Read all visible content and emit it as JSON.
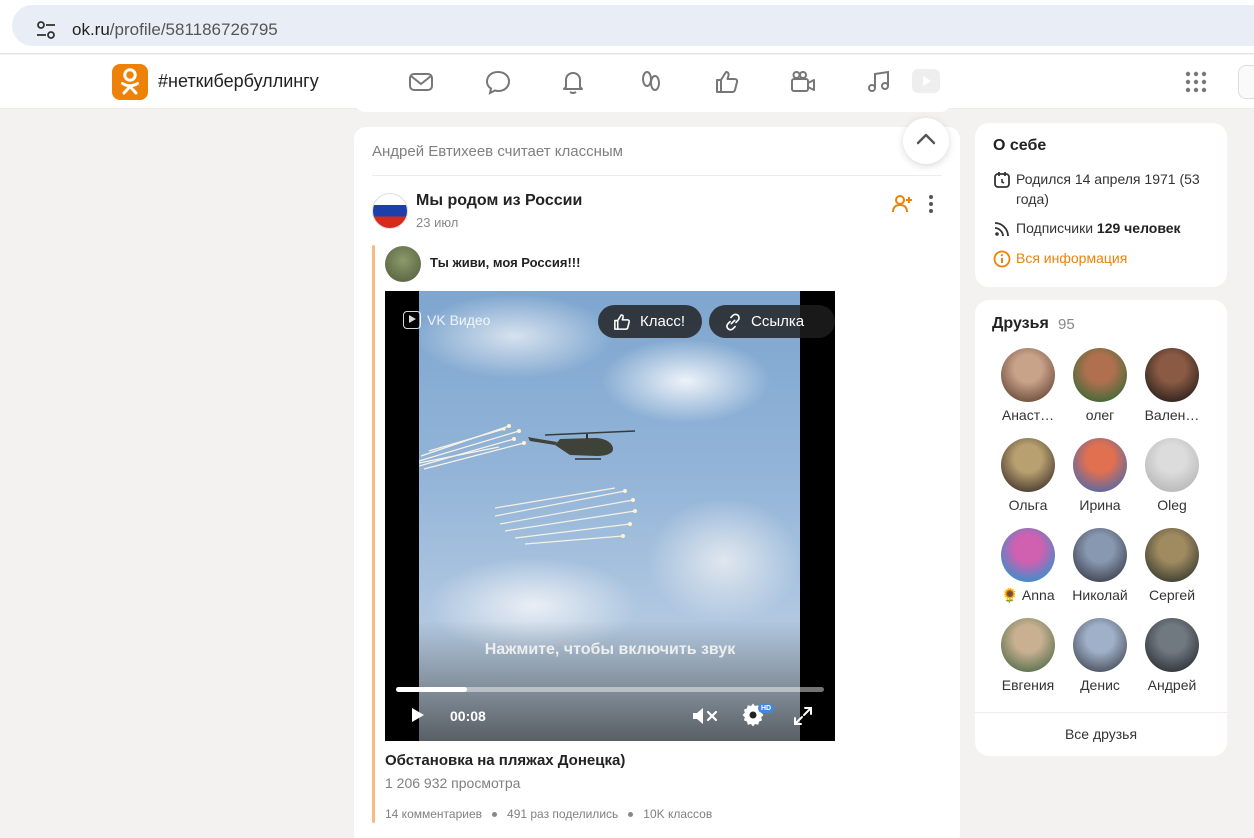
{
  "browser": {
    "url_domain": "ok.ru",
    "url_path": "/profile/581186726795"
  },
  "nav": {
    "brand": "#неткибербуллингу",
    "icons": [
      "mail-icon",
      "chat-icon",
      "bell-icon",
      "guests-icon",
      "like-icon",
      "camera-icon",
      "music-icon",
      "video-icon",
      "apps-icon"
    ]
  },
  "feed": {
    "header": "Андрей Евтихеев считает классным",
    "post": {
      "group_name": "Мы родом из России",
      "date": "23 июл",
      "repost_text": "Ты живи, моя Россия!!!",
      "video": {
        "brand": "VK Видео",
        "like_label": "Класс!",
        "link_label": "Ссылка",
        "sound_hint": "Нажмите, чтобы включить звук",
        "time": "00:08",
        "progress": 0.165,
        "hd_badge": "HD"
      },
      "video_title": "Обстановка на пляжах Донецка)",
      "views": "1 206 932 просмотра",
      "stats": {
        "comments": "14 комментариев",
        "shares": "491 раз поделились",
        "likes": "10K классов"
      }
    }
  },
  "about": {
    "title": "О себе",
    "born": "Родился 14 апреля 1971 (53 года)",
    "followers_prefix": "Подписчики",
    "followers_count": "129 человек",
    "all_info": "Вся информация"
  },
  "friends": {
    "title": "Друзья",
    "count": "95",
    "items": [
      {
        "name": "Анаст…",
        "color_a": "#c9a28a",
        "color_b": "#7a5a48"
      },
      {
        "name": "олег",
        "color_a": "#b0704f",
        "color_b": "#4f6b3a"
      },
      {
        "name": "Вален…",
        "color_a": "#8b5a44",
        "color_b": "#3a2a22"
      },
      {
        "name": "Ольга",
        "color_a": "#b8a070",
        "color_b": "#5a4a3a"
      },
      {
        "name": "Ирина",
        "color_a": "#e07050",
        "color_b": "#6a6a9a"
      },
      {
        "name": "Oleg",
        "color_a": "#dcdcdc",
        "color_b": "#bdbdbd"
      },
      {
        "name": "🌻 Anna",
        "color_a": "#d060b0",
        "color_b": "#4a8ac8"
      },
      {
        "name": "Николай",
        "color_a": "#8898b0",
        "color_b": "#4a5060"
      },
      {
        "name": "Сергей",
        "color_a": "#a08a60",
        "color_b": "#4a4a38"
      },
      {
        "name": "Евгения",
        "color_a": "#c8b090",
        "color_b": "#6a7a58"
      },
      {
        "name": "Денис",
        "color_a": "#a0b0c8",
        "color_b": "#586070"
      },
      {
        "name": "Андрей",
        "color_a": "#707880",
        "color_b": "#3a3e44"
      }
    ],
    "all_label": "Все друзья"
  }
}
